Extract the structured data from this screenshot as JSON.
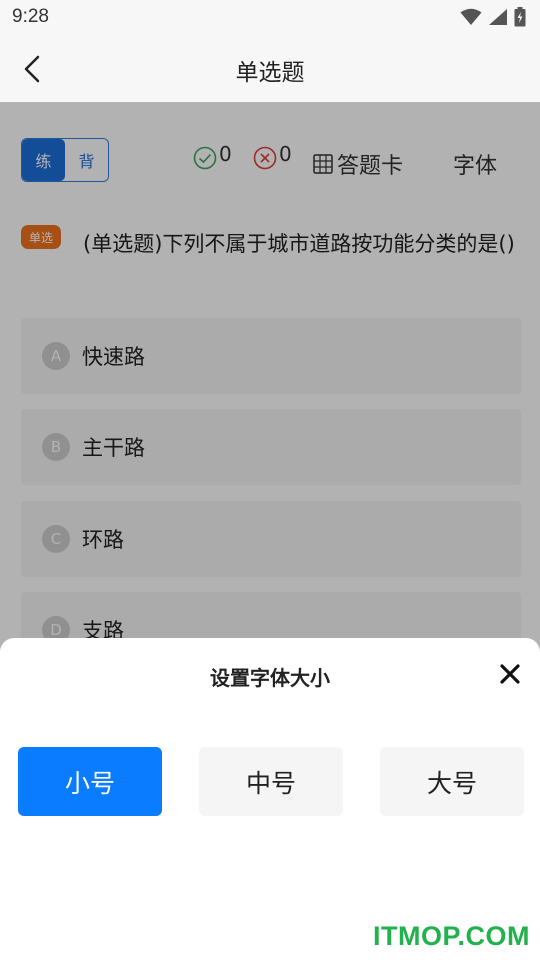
{
  "status_bar": {
    "time": "9:28"
  },
  "header": {
    "title": "单选题"
  },
  "mode_toggle": {
    "practice": "练",
    "recite": "背"
  },
  "stats": {
    "correct": "0",
    "wrong": "0"
  },
  "toolbar": {
    "answer_card": "答题卡",
    "font": "字体"
  },
  "question": {
    "badge": "单选",
    "text": "(单选题)下列不属于城市道路按功能分类的是()",
    "options": [
      {
        "letter": "A",
        "text": "快速路"
      },
      {
        "letter": "B",
        "text": "主干路"
      },
      {
        "letter": "C",
        "text": "环路"
      },
      {
        "letter": "D",
        "text": "支路"
      }
    ]
  },
  "font_sheet": {
    "title": "设置字体大小",
    "options": [
      "小号",
      "中号",
      "大号"
    ],
    "selected": "小号"
  },
  "watermark": "ITMOP.COM",
  "colors": {
    "accent": "#0a7cff",
    "badge": "#f0731f",
    "correct": "#3aa55d",
    "wrong": "#e23b3b",
    "watermark": "#22b14c"
  }
}
